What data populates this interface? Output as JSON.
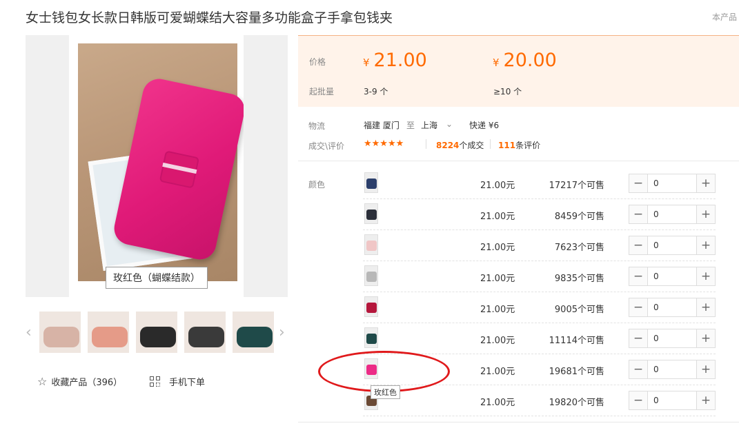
{
  "product": {
    "title": "女士钱包女长款日韩版可爱蝴蝶结大容量多功能盒子手拿包钱夹",
    "corner_text": "本产品"
  },
  "gallery": {
    "caption": "玫红色（蝴蝶结款）",
    "prev_arrow": "‹",
    "next_arrow": "›",
    "thumbnails": [
      {
        "color": "#d7b3a6"
      },
      {
        "color": "#e59b88"
      },
      {
        "color": "#2a2a2a"
      },
      {
        "color": "#3a3a3a"
      },
      {
        "color": "#1f4a49"
      }
    ]
  },
  "actions": {
    "favorite_label": "收藏产品（396）",
    "favorite_icon": "star-outline-icon",
    "mobile_label": "手机下单",
    "mobile_icon": "qr-code-icon"
  },
  "pricing": {
    "price_label": "价格",
    "moq_label": "起批量",
    "currency": "¥",
    "tiers": [
      {
        "price": "21.00",
        "range": "3-9 个"
      },
      {
        "price": "20.00",
        "range": "≥10 个"
      }
    ]
  },
  "logistics": {
    "label": "物流",
    "from": "福建 厦门",
    "to_word": "至",
    "dest": "上海",
    "shipping": "快递 ¥6"
  },
  "reviews": {
    "label": "成交\\评价",
    "stars": "★★★★★",
    "deals_count": "8224",
    "deals_suffix": "个成交",
    "review_count": "111",
    "review_suffix": "条评价"
  },
  "sku": {
    "label": "颜色",
    "tooltip": "玫红色",
    "rows": [
      {
        "swatch": "#2c3f6b",
        "price": "21.00元",
        "stock": "17217个可售",
        "qty": "0"
      },
      {
        "swatch": "#2b2f3a",
        "price": "21.00元",
        "stock": "8459个可售",
        "qty": "0"
      },
      {
        "swatch": "#f0c6c6",
        "price": "21.00元",
        "stock": "7623个可售",
        "qty": "0"
      },
      {
        "swatch": "#b8b8b8",
        "price": "21.00元",
        "stock": "9835个可售",
        "qty": "0"
      },
      {
        "swatch": "#b5173c",
        "price": "21.00元",
        "stock": "9005个可售",
        "qty": "0"
      },
      {
        "swatch": "#1f4a49",
        "price": "21.00元",
        "stock": "11114个可售",
        "qty": "0"
      },
      {
        "swatch": "#ec2b86",
        "price": "21.00元",
        "stock": "19681个可售",
        "qty": "0"
      },
      {
        "swatch": "#6b4a35",
        "price": "21.00元",
        "stock": "19820个可售",
        "qty": "0"
      }
    ]
  },
  "annotation": {
    "color": "#e0191b"
  }
}
